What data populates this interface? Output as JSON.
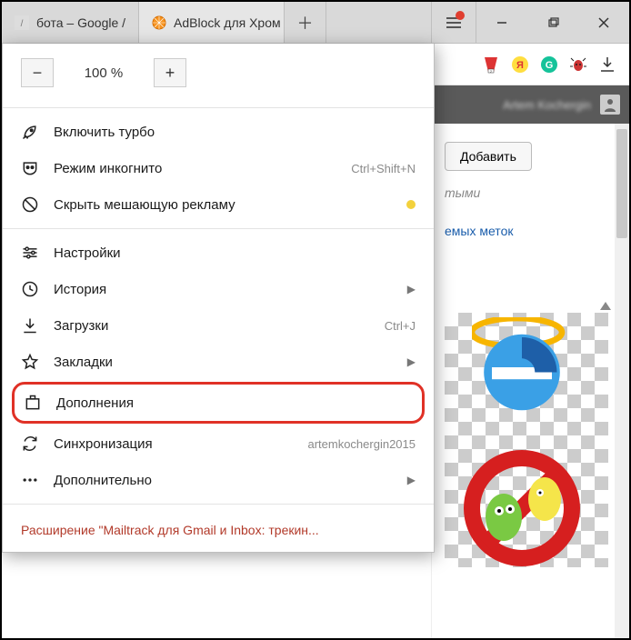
{
  "tabs": [
    {
      "label": "бота – Google /",
      "favicon": "generic"
    },
    {
      "label": "AdBlock для Хром",
      "favicon": "orange"
    }
  ],
  "window": {
    "zoom_minus": "−",
    "zoom_value": "100 %",
    "zoom_plus": "+"
  },
  "menu": {
    "turbo": "Включить турбо",
    "incognito": "Режим инкогнито",
    "incognito_hint": "Ctrl+Shift+N",
    "hide_ads": "Скрыть мешающую рекламу",
    "settings": "Настройки",
    "history": "История",
    "downloads": "Загрузки",
    "downloads_hint": "Ctrl+J",
    "bookmarks": "Закладки",
    "addons": "Дополнения",
    "sync": "Синхронизация",
    "sync_hint": "artemkochergin2015",
    "more": "Дополнительно",
    "footer": "Расширение \"Mailtrack для Gmail и Inbox: трекин..."
  },
  "page": {
    "add_button": "Добавить",
    "muted_text": "тыми",
    "link_text": "емых меток",
    "user_name": "Artem Kochergin"
  }
}
